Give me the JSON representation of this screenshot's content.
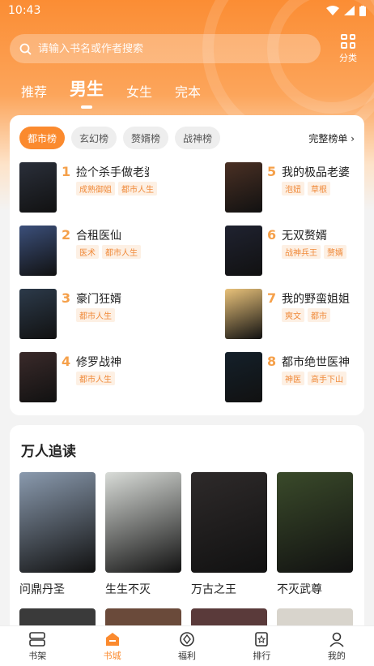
{
  "status": {
    "time": "10:43"
  },
  "search": {
    "placeholder": "请输入书名或作者搜索"
  },
  "header": {
    "category_label": "分类"
  },
  "tabs": [
    {
      "label": "推荐"
    },
    {
      "label": "男生"
    },
    {
      "label": "女生"
    },
    {
      "label": "完本"
    }
  ],
  "rank": {
    "tabs": [
      {
        "label": "都市榜"
      },
      {
        "label": "玄幻榜"
      },
      {
        "label": "赘婿榜"
      },
      {
        "label": "战神榜"
      }
    ],
    "more_label": "完整榜单",
    "items": [
      {
        "num": "1",
        "title": "捡个杀手做老婆",
        "tags": [
          "成熟御姐",
          "都市人生"
        ],
        "cover_color": "#2a2f3a"
      },
      {
        "num": "2",
        "title": "合租医仙",
        "tags": [
          "医术",
          "都市人生"
        ],
        "cover_color": "#3b4f7a"
      },
      {
        "num": "3",
        "title": "豪门狂婿",
        "tags": [
          "都市人生"
        ],
        "cover_color": "#2c3a4a"
      },
      {
        "num": "4",
        "title": "修罗战神",
        "tags": [
          "都市人生"
        ],
        "cover_color": "#3a2a2a"
      },
      {
        "num": "5",
        "title": "我的极品老婆",
        "tags": [
          "泡妞",
          "草根"
        ],
        "cover_color": "#4a3024"
      },
      {
        "num": "6",
        "title": "无双赘婿",
        "tags": [
          "战神兵王",
          "赘婿"
        ],
        "cover_color": "#1f2230"
      },
      {
        "num": "7",
        "title": "我的野蛮姐姐",
        "tags": [
          "爽文",
          "都市"
        ],
        "cover_color": "#e9c27a"
      },
      {
        "num": "8",
        "title": "都市绝世医神",
        "tags": [
          "神医",
          "高手下山"
        ],
        "cover_color": "#14202a"
      }
    ]
  },
  "hot": {
    "title": "万人追读",
    "books": [
      {
        "name": "问鼎丹圣",
        "cover_color": "#8a9aae"
      },
      {
        "name": "生生不灭",
        "cover_color": "#d9dcd8"
      },
      {
        "name": "万古之王",
        "cover_color": "#2e2a2a"
      },
      {
        "name": "不灭武尊",
        "cover_color": "#3a4a2a"
      }
    ]
  },
  "nav": [
    {
      "label": "书架",
      "icon": "bookshelf-icon"
    },
    {
      "label": "书城",
      "icon": "bookstore-icon"
    },
    {
      "label": "福利",
      "icon": "welfare-icon"
    },
    {
      "label": "排行",
      "icon": "ranking-icon"
    },
    {
      "label": "我的",
      "icon": "profile-icon"
    }
  ],
  "colors": {
    "accent": "#fb8a2e",
    "header_top": "#fb8d34"
  }
}
